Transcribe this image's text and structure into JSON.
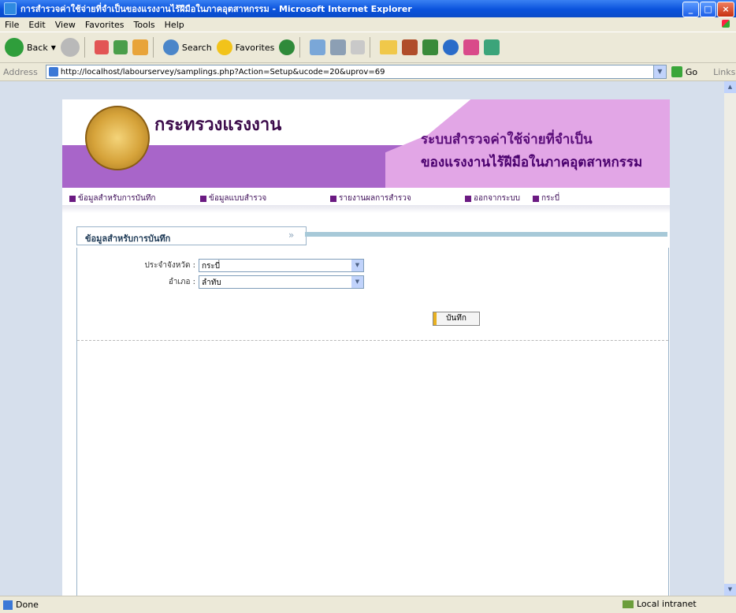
{
  "window": {
    "title": "การสำรวจค่าใช้จ่ายที่จำเป็นของแรงงานไร้ฝีมือในภาคอุตสาหกรรม - Microsoft Internet Explorer"
  },
  "menu": [
    "File",
    "Edit",
    "View",
    "Favorites",
    "Tools",
    "Help"
  ],
  "toolbar": {
    "back_label": "Back",
    "search_label": "Search",
    "favorites_label": "Favorites"
  },
  "address": {
    "label": "Address",
    "url": "http://localhost/labourservey/samplings.php?Action=Setup&ucode=20&uprov=69",
    "go_label": "Go",
    "links_label": "Links"
  },
  "banner": {
    "ministry": "กระทรวงแรงงาน",
    "system_line1": "ระบบสำรวจค่าใช้จ่ายที่จำเป็น",
    "system_line2": "ของแรงงานไร้ฝีมือในภาคอุตสาหกรรม"
  },
  "nav": [
    "ข้อมูลสำหรับการบันทึก",
    "ข้อมูลแบบสำรวจ",
    "รายงานผลการสำรวจ",
    "ออกจากระบบ",
    "กระบี่"
  ],
  "panel": {
    "title": "ข้อมูลสำหรับการบันทึก",
    "province_label": "ประจำจังหวัด :",
    "province_value": "กระบี่",
    "district_label": "อำเภอ :",
    "district_value": "ลำทับ",
    "save_button": "บันทึก"
  },
  "status": {
    "left": "Done",
    "zone": "Local intranet"
  }
}
